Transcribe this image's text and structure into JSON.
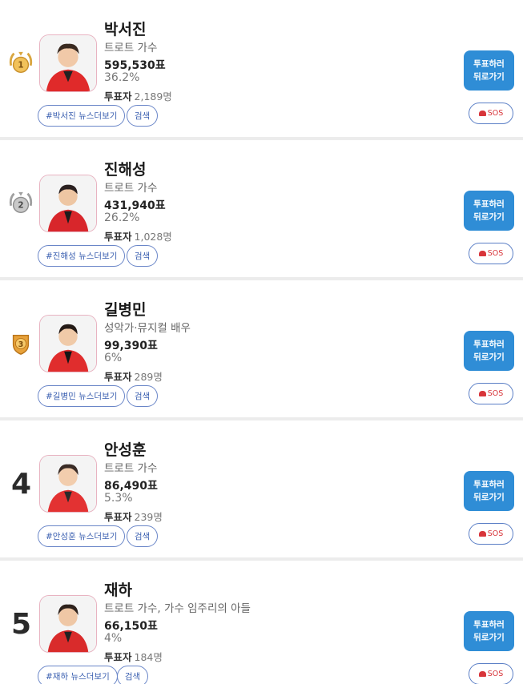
{
  "vote_button": {
    "line1": "투표하러",
    "line2": "뒤로가기"
  },
  "sos_label": "SOS",
  "voters_label": "투표자",
  "search_label": "검색",
  "rank_colors": {
    "gold": "#e0a93a",
    "silver": "#a9a9a9",
    "bronze": "#c98226"
  },
  "candidates": [
    {
      "rank": "1",
      "name": "박서진",
      "role": "트로트 가수",
      "votes": "595,530표",
      "percent": "36.2%",
      "voters": "2,189명",
      "news_tag": "#박서진 뉴스더보기"
    },
    {
      "rank": "2",
      "name": "진해성",
      "role": "트로트 가수",
      "votes": "431,940표",
      "percent": "26.2%",
      "voters": "1,028명",
      "news_tag": "#진해성 뉴스더보기"
    },
    {
      "rank": "3",
      "name": "길병민",
      "role": "성악가·뮤지컬 배우",
      "votes": "99,390표",
      "percent": "6%",
      "voters": "289명",
      "news_tag": "#길병민 뉴스더보기"
    },
    {
      "rank": "4",
      "name": "안성훈",
      "role": "트로트 가수",
      "votes": "86,490표",
      "percent": "5.3%",
      "voters": "239명",
      "news_tag": "#안성훈 뉴스더보기"
    },
    {
      "rank": "5",
      "name": "재하",
      "role": "트로트 가수, 가수 임주리의 아들",
      "votes": "66,150표",
      "percent": "4%",
      "voters": "184명",
      "news_tag": "#재하 뉴스더보기"
    }
  ]
}
